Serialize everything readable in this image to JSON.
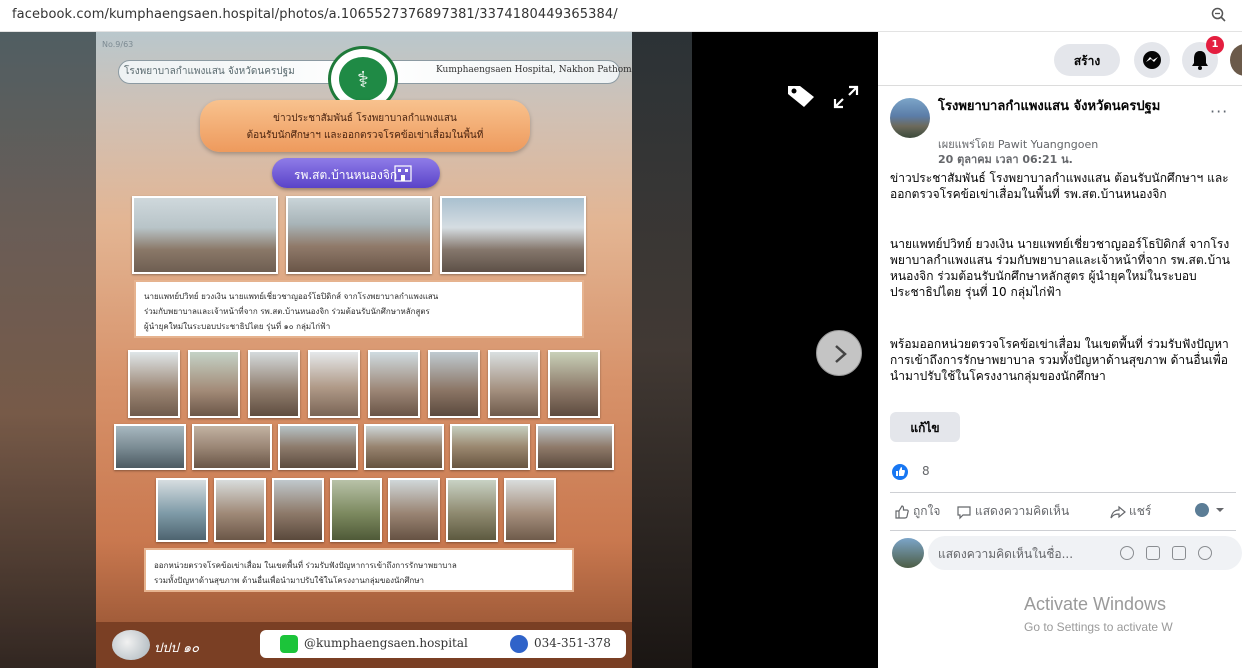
{
  "browser": {
    "url": "facebook.com/kumphaengsaen.hospital/photos/a.1065527376897381/3374180449365384/"
  },
  "poster": {
    "issue_no": "No.9/63",
    "hospital_th": "โรงพยาบาลกำแพงแสน จังหวัดนครปฐม",
    "hospital_en": "Kumphaengsaen Hospital, Nakhon Pathom",
    "headline_l1": "ข่าวประชาสัมพันธ์ โรงพยาบาลกำแพงแสน",
    "headline_l2": "ต้อนรับนักศึกษาฯ และออกตรวจโรคข้อเข่าเสื่อมในพื้นที่",
    "place": "รพ.สต.บ้านหนองจิก",
    "caption1_l1": "นายแพทย์ปวิทย์ ยวงเงิน นายแพทย์เชี่ยวชาญออร์โธปิดิกส์ จากโรงพยาบาลกำแพงแสน",
    "caption1_l2": "ร่วมกับพยาบาลและเจ้าหน้าที่จาก รพ.สต.บ้านหนองจิก ร่วมต้อนรับนักศึกษาหลักสูตร",
    "caption1_l3": "ผู้นำยุคใหม่ในระบอบประชาธิปไตย รุ่นที่ ๑๐ กลุ่มไก่ฟ้า",
    "caption2_l1": "ออกหน่วยตรวจโรคข้อเข่าเสื่อม ในเขตพื้นที่ ร่วมรับฟังปัญหาการเข้าถึงการรักษาพยาบาล",
    "caption2_l2": "รวมทั้งปัญหาด้านสุขภาพ ด้านอื่นเพื่อนำมาปรับใช้ในโครงงานกลุ่มของนักศึกษา",
    "footer_ppp": "ปปป ๑๐",
    "line_id": "@kumphaengsaen.hospital",
    "phone": "034-351-378"
  },
  "topbar": {
    "create_label": "สร้าง",
    "notification_count": "1"
  },
  "post": {
    "page_name": "โรงพยาบาลกำแพงแสน จังหวัดนครปฐม",
    "published_by": "เผยแพร่โดย Pawit Yuangngoen",
    "date": "20 ตุลาคม เวลา 06:21 น.",
    "para1": "ข่าวประชาสัมพันธ์ โรงพยาบาลกำแพงแสน ต้อนรับนักศึกษาฯ และออกตรวจโรคข้อเข่าเสื่อมในพื้นที่ รพ.สต.บ้านหนองจิก",
    "para2": "นายแพทย์ปวิทย์ ยวงเงิน นายแพทย์เชี่ยวชาญออร์โธปิดิกส์ จากโรงพยาบาลกำแพงแสน ร่วมกับพยาบาลและเจ้าหน้าที่จาก รพ.สต.บ้านหนองจิก ร่วมต้อนรับนักศึกษาหลักสูตร ผู้นำยุคใหม่ในระบอบประชาธิปไตย รุ่นที่ 10 กลุ่มไก่ฟ้า",
    "para3": "พร้อมออกหน่วยตรวจโรคข้อเข่าเสื่อม ในเขตพื้นที่ ร่วมรับฟังปัญหาการเข้าถึงการรักษาพยาบาล รวมทั้งปัญหาด้านสุขภาพ ด้านอื่นเพื่อนำมาปรับใช้ในโครงงานกลุ่มของนักศึกษา",
    "edit_label": "แก้ไข",
    "like_count": "8",
    "like_label": "ถูกใจ",
    "comment_label": "แสดงความคิดเห็น",
    "share_label": "แชร์",
    "comment_placeholder": "แสดงความคิดเห็นในชื่อ..."
  },
  "watermark": {
    "line1": "Activate Windows",
    "line2": "Go to Settings to activate W"
  },
  "colors": {
    "facebook_blue": "#1877f2",
    "badge_red": "#e41e3f"
  }
}
